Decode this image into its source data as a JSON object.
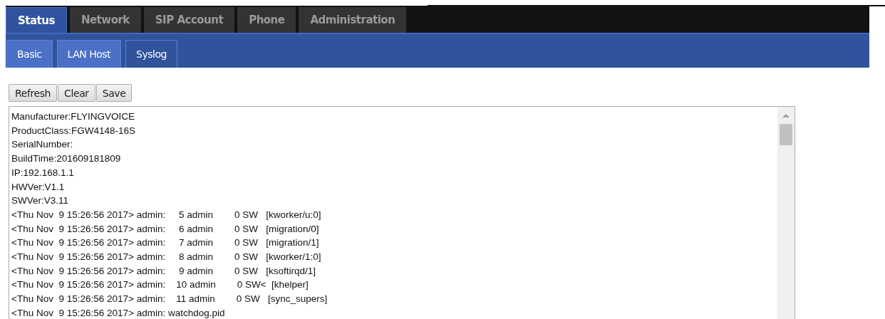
{
  "main_tabs": [
    {
      "label": "Status",
      "selected": true
    },
    {
      "label": "Network",
      "selected": false
    },
    {
      "label": "SIP Account",
      "selected": false
    },
    {
      "label": "Phone",
      "selected": false
    },
    {
      "label": "Administration",
      "selected": false
    }
  ],
  "sub_tabs": [
    {
      "label": "Basic",
      "selected": false
    },
    {
      "label": "LAN Host",
      "selected": false
    },
    {
      "label": "Syslog",
      "selected": true
    }
  ],
  "buttons": [
    "Refresh",
    "Clear",
    "Save"
  ],
  "log_lines": [
    "Manufacturer:FLYINGVOICE",
    "ProductClass:FGW4148-16S",
    "SerialNumber:",
    "BuildTime:201609181809",
    "IP:192.168.1.1",
    "HWVer:V1.1",
    "SWVer:V3.11",
    "<Thu Nov  9 15:26:56 2017> admin:     5 admin        0 SW   [kworker/u:0]",
    "<Thu Nov  9 15:26:56 2017> admin:     6 admin        0 SW   [migration/0]",
    "<Thu Nov  9 15:26:56 2017> admin:     7 admin        0 SW   [migration/1]",
    "<Thu Nov  9 15:26:56 2017> admin:     8 admin        0 SW   [kworker/1:0]",
    "<Thu Nov  9 15:26:56 2017> admin:     9 admin        0 SW   [ksoftirqd/1]",
    "<Thu Nov  9 15:26:56 2017> admin:    10 admin        0 SW<  [khelper]",
    "<Thu Nov  9 15:26:56 2017> admin:    11 admin        0 SW   [sync_supers]",
    "<Thu Nov  9 15:26:56 2017> admin: watchdog.pid"
  ]
}
